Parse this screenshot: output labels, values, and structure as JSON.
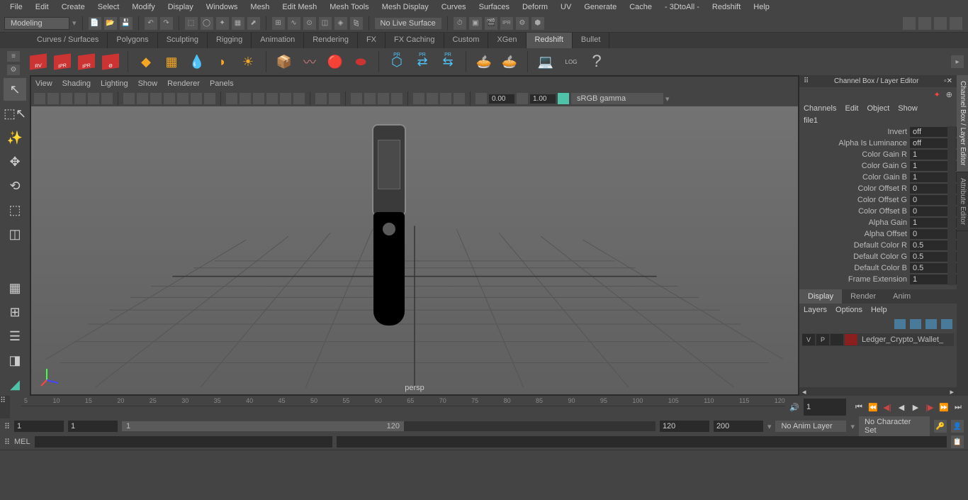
{
  "menubar": [
    "File",
    "Edit",
    "Create",
    "Select",
    "Modify",
    "Display",
    "Windows",
    "Mesh",
    "Edit Mesh",
    "Mesh Tools",
    "Mesh Display",
    "Curves",
    "Surfaces",
    "Deform",
    "UV",
    "Generate",
    "Cache",
    "- 3DtoAll -",
    "Redshift",
    "Help"
  ],
  "workspace": "Modeling",
  "no_live": "No Live Surface",
  "shelf_tabs": [
    "Curves / Surfaces",
    "Polygons",
    "Sculpting",
    "Rigging",
    "Animation",
    "Rendering",
    "FX",
    "FX Caching",
    "Custom",
    "XGen",
    "Redshift",
    "Bullet"
  ],
  "shelf_active": "Redshift",
  "viewport_menu": [
    "View",
    "Shading",
    "Lighting",
    "Show",
    "Renderer",
    "Panels"
  ],
  "vp_exposure": "0.00",
  "vp_gamma": "1.00",
  "color_space": "sRGB gamma",
  "camera": "persp",
  "right_panel_title": "Channel Box / Layer Editor",
  "channel_menu": [
    "Channels",
    "Edit",
    "Object",
    "Show"
  ],
  "selected_node": "file1",
  "attrs": [
    {
      "name": "Invert",
      "val": "off"
    },
    {
      "name": "Alpha Is Luminance",
      "val": "off"
    },
    {
      "name": "Color Gain R",
      "val": "1"
    },
    {
      "name": "Color Gain G",
      "val": "1"
    },
    {
      "name": "Color Gain B",
      "val": "1"
    },
    {
      "name": "Color Offset R",
      "val": "0"
    },
    {
      "name": "Color Offset G",
      "val": "0"
    },
    {
      "name": "Color Offset B",
      "val": "0"
    },
    {
      "name": "Alpha Gain",
      "val": "1"
    },
    {
      "name": "Alpha Offset",
      "val": "0"
    },
    {
      "name": "Default Color R",
      "val": "0.5"
    },
    {
      "name": "Default Color G",
      "val": "0.5"
    },
    {
      "name": "Default Color B",
      "val": "0.5"
    },
    {
      "name": "Frame Extension",
      "val": "1"
    }
  ],
  "layer_tabs": [
    "Display",
    "Render",
    "Anim"
  ],
  "layer_menu": [
    "Layers",
    "Options",
    "Help"
  ],
  "layer_name": "Ledger_Crypto_Wallet_",
  "vertical_tabs": [
    "Channel Box / Layer Editor",
    "Attribute Editor"
  ],
  "timeline_ticks": [
    "5",
    "10",
    "15",
    "20",
    "25",
    "30",
    "35",
    "40",
    "45",
    "50",
    "55",
    "60",
    "65",
    "70",
    "75",
    "80",
    "85",
    "90",
    "95",
    "100",
    "105",
    "110",
    "115",
    "120"
  ],
  "time_current": "1",
  "time_end_vis": "1",
  "range_start": "1",
  "range_start2": "1",
  "range_end": "120",
  "range_slider_val": "1",
  "range_end2": "120",
  "range_end3": "200",
  "anim_layer": "No Anim Layer",
  "char_set": "No Character Set",
  "mel_label": "MEL",
  "red_cubes": [
    "RV",
    "IPR",
    "IPR",
    ""
  ],
  "pr_labels": [
    "PR",
    "PR",
    "PR"
  ]
}
